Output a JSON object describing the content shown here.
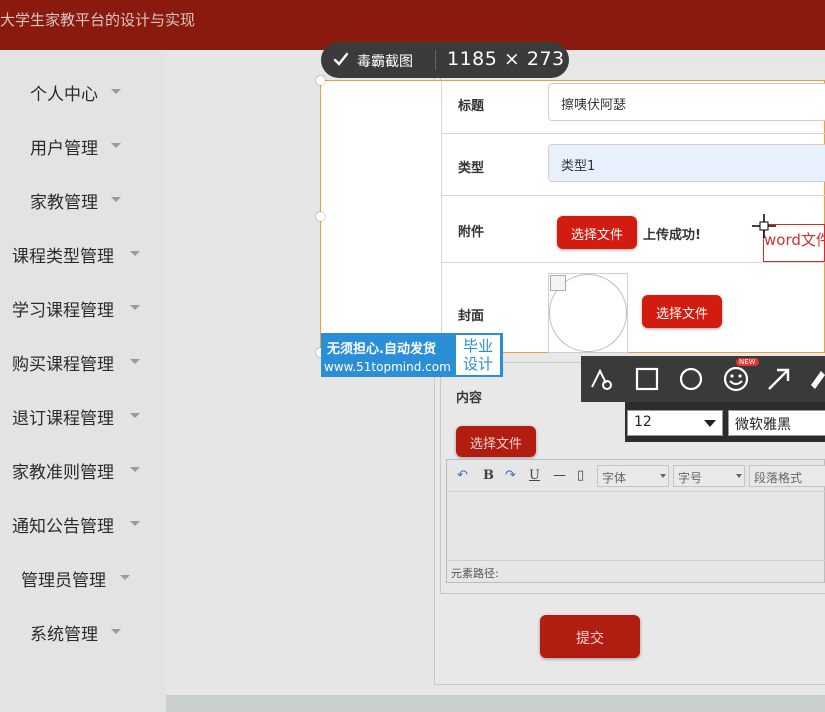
{
  "header": {
    "title": "大学生家教平台的设计与实现"
  },
  "sidebar": {
    "items": [
      {
        "label": "个人中心"
      },
      {
        "label": "用户管理"
      },
      {
        "label": "家教管理"
      },
      {
        "label": "课程类型管理"
      },
      {
        "label": "学习课程管理"
      },
      {
        "label": "购买课程管理"
      },
      {
        "label": "退订课程管理"
      },
      {
        "label": "家教准则管理"
      },
      {
        "label": "通知公告管理"
      },
      {
        "label": "管理员管理"
      },
      {
        "label": "系统管理"
      }
    ]
  },
  "capture": {
    "brand": "毒霸截图",
    "size": "1185 × 273"
  },
  "form": {
    "title_label": "标题",
    "title_value": "擦咦伏阿瑟",
    "type_label": "类型",
    "type_value": "类型1",
    "attachment_label": "附件",
    "choose_file": "选择文件",
    "upload_status": "上传成功!",
    "cover_label": "封面",
    "content_label": "内容",
    "submit": "提交"
  },
  "editor": {
    "font_label": "字体",
    "size_label": "字号",
    "para_label": "段落格式",
    "path_label": "元素路径:"
  },
  "watermark": {
    "line1": "无须担心.自动发货",
    "line2": "www.51topmind.com",
    "box_line1": "毕业",
    "box_line2": "设计"
  },
  "draw_toolbar": {
    "new_badge": "NEW",
    "font_size": "12",
    "font_name": "微软雅黑"
  },
  "text_box": {
    "text": "word文件"
  },
  "colors": {
    "header": "#8a1a0e",
    "button": "#d21c10",
    "watermark": "#2b8fd8"
  }
}
